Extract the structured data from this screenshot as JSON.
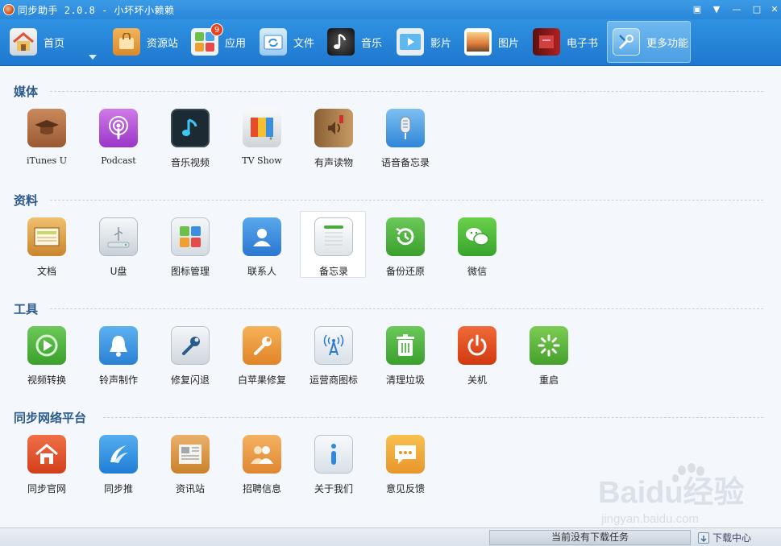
{
  "window": {
    "title": "同步助手 2.0.8 - 小坏坏小赖赖",
    "buttons": [
      "pin",
      "minimize-to-tray",
      "minimize",
      "maximize",
      "close"
    ]
  },
  "toolbar": {
    "items": [
      {
        "label": "首页",
        "icon": "home-icon",
        "has_dropdown": true
      },
      {
        "label": "资源站",
        "icon": "shopping-bag-icon"
      },
      {
        "label": "应用",
        "icon": "apps-icon",
        "badge": "9"
      },
      {
        "label": "文件",
        "icon": "folder-sync-icon"
      },
      {
        "label": "音乐",
        "icon": "music-note-icon"
      },
      {
        "label": "影片",
        "icon": "play-screen-icon"
      },
      {
        "label": "图片",
        "icon": "photo-icon"
      },
      {
        "label": "电子书",
        "icon": "book-icon"
      },
      {
        "label": "更多功能",
        "icon": "tools-icon",
        "active": true
      }
    ]
  },
  "sections": [
    {
      "title": "媒体",
      "items": [
        {
          "label": "iTunes U",
          "icon": "graduation-cap-icon",
          "color": "#a8673f"
        },
        {
          "label": "Podcast",
          "icon": "podcast-icon",
          "color": "#b04bd6"
        },
        {
          "label": "音乐视频",
          "icon": "music-video-icon",
          "color": "#1f3340"
        },
        {
          "label": "TV Show",
          "icon": "tv-icon",
          "color": "#e8e8e8"
        },
        {
          "label": "有声读物",
          "icon": "audiobook-icon",
          "color": "#b88a55"
        },
        {
          "label": "语音备忘录",
          "icon": "microphone-icon",
          "color": "#4aa0e8"
        }
      ]
    },
    {
      "title": "资料",
      "items": [
        {
          "label": "文档",
          "icon": "document-box-icon",
          "color": "#d9a54c"
        },
        {
          "label": "U盘",
          "icon": "usb-drive-icon",
          "color": "#e4e8ec"
        },
        {
          "label": "图标管理",
          "icon": "icon-grid-icon",
          "color": "#e8ecf0"
        },
        {
          "label": "联系人",
          "icon": "contacts-icon",
          "color": "#3a8fe0"
        },
        {
          "label": "备忘录",
          "icon": "notes-icon",
          "color": "#eef0f2",
          "highlighted": true
        },
        {
          "label": "备份还原",
          "icon": "backup-restore-icon",
          "color": "#4cb544"
        },
        {
          "label": "微信",
          "icon": "wechat-icon",
          "color": "#4fbf3c"
        }
      ]
    },
    {
      "title": "工具",
      "items": [
        {
          "label": "视频转换",
          "icon": "video-convert-icon",
          "color": "#4cb544"
        },
        {
          "label": "铃声制作",
          "icon": "bell-icon",
          "color": "#3a9ae4"
        },
        {
          "label": "修复闪退",
          "icon": "wrench-icon",
          "color": "#e2e6ea"
        },
        {
          "label": "白苹果修复",
          "icon": "wrench-orange-icon",
          "color": "#ee9a3c"
        },
        {
          "label": "运营商图标",
          "icon": "signal-tower-icon",
          "color": "#e4eaf0"
        },
        {
          "label": "清理垃圾",
          "icon": "trash-icon",
          "color": "#4cb544"
        },
        {
          "label": "关机",
          "icon": "power-icon",
          "color": "#e2461c"
        },
        {
          "label": "重启",
          "icon": "restart-icon",
          "color": "#5ab43c"
        }
      ]
    },
    {
      "title": "同步网络平台",
      "items": [
        {
          "label": "同步官网",
          "icon": "home-red-icon",
          "color": "#e2512c"
        },
        {
          "label": "同步推",
          "icon": "tongbutui-icon",
          "color": "#2f93e6"
        },
        {
          "label": "资讯站",
          "icon": "newspaper-icon",
          "color": "#d89a4a"
        },
        {
          "label": "招聘信息",
          "icon": "people-icon",
          "color": "#e8963c"
        },
        {
          "label": "关于我们",
          "icon": "info-icon",
          "color": "#e6ebf0"
        },
        {
          "label": "意见反馈",
          "icon": "feedback-icon",
          "color": "#f0a93a"
        }
      ]
    }
  ],
  "statusbar": {
    "download_status": "当前没有下载任务",
    "download_center": "下载中心"
  },
  "watermark": {
    "brand": "Baidu经验",
    "url": "jingyan.baidu.com"
  }
}
